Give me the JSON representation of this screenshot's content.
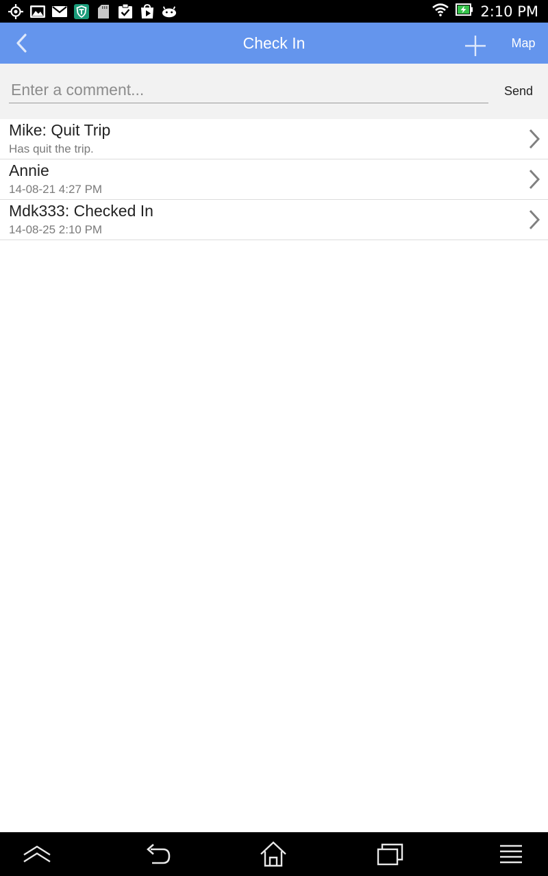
{
  "status_bar": {
    "time": "2:10 PM",
    "left_icons": [
      "gps-icon",
      "image-icon",
      "email-icon",
      "shield-icon",
      "sd-card-icon",
      "task-icon",
      "play-store-icon",
      "android-icon"
    ],
    "right_icons": [
      "wifi-icon",
      "battery-charging-icon"
    ]
  },
  "action_bar": {
    "title": "Check In",
    "back_icon": "chevron-left-icon",
    "add_icon": "plus-icon",
    "map_label": "Map",
    "background_color": "#6495ed"
  },
  "comment": {
    "placeholder": "Enter a comment...",
    "value": "",
    "send_label": "Send"
  },
  "checkins": [
    {
      "title": "Mike: Quit Trip",
      "subtitle": "Has quit the trip."
    },
    {
      "title": "Annie",
      "subtitle": "14-08-21 4:27 PM"
    },
    {
      "title": "Mdk333: Checked In",
      "subtitle": "14-08-25 2:10 PM"
    }
  ],
  "nav_bar": {
    "buttons": [
      "expand-up-icon",
      "back-icon",
      "home-icon",
      "recent-apps-icon",
      "menu-icon"
    ]
  }
}
